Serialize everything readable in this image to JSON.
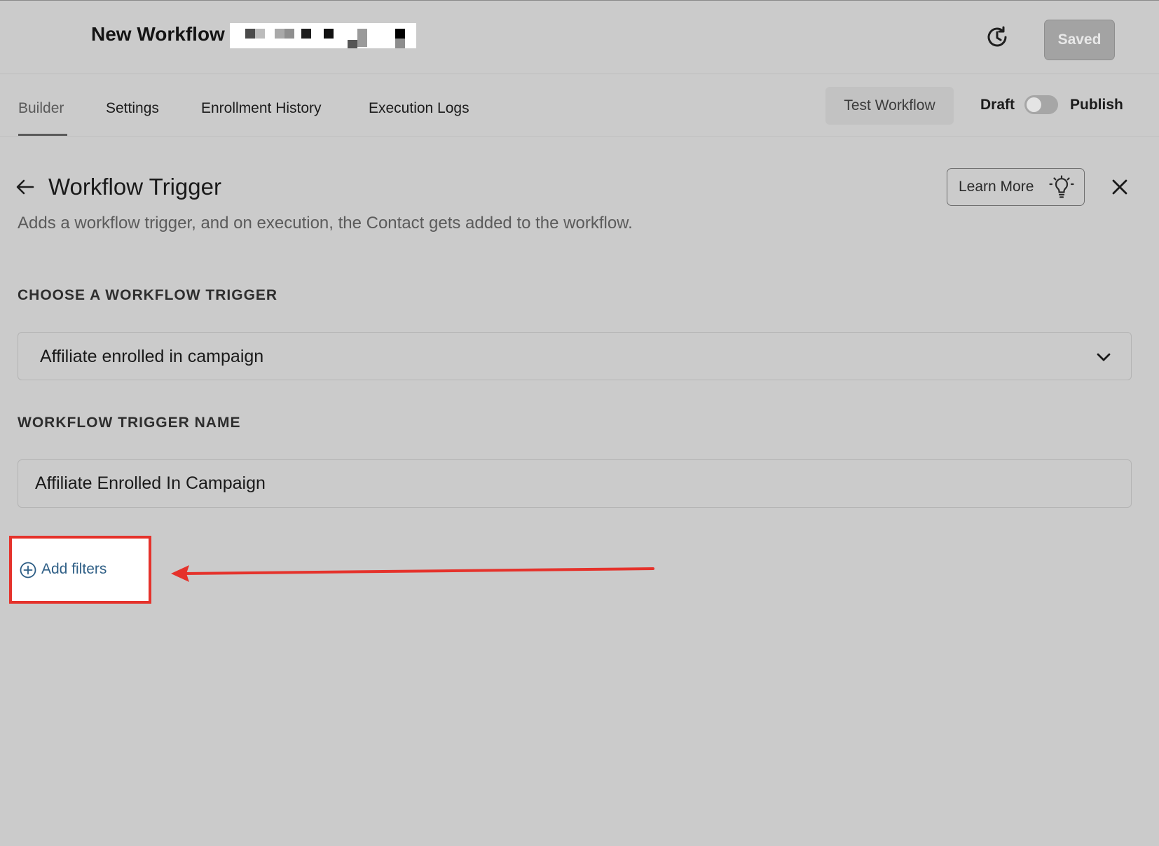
{
  "header": {
    "workflow_title": "New Workflow",
    "saved_label": "Saved"
  },
  "tabs": [
    {
      "label": "Builder",
      "active": true
    },
    {
      "label": "Settings",
      "active": false
    },
    {
      "label": "Enrollment History",
      "active": false
    },
    {
      "label": "Execution Logs",
      "active": false
    }
  ],
  "toolbar": {
    "test_label": "Test Workflow",
    "draft_label": "Draft",
    "publish_label": "Publish",
    "published": false
  },
  "panel": {
    "title": "Workflow Trigger",
    "description": "Adds a workflow trigger, and on execution, the Contact gets added to the workflow.",
    "learn_more_label": "Learn More",
    "trigger_section_label": "CHOOSE A WORKFLOW TRIGGER",
    "trigger_selected": "Affiliate enrolled in campaign",
    "name_section_label": "WORKFLOW TRIGGER NAME",
    "name_value": "Affiliate Enrolled In Campaign",
    "add_filters_label": "Add filters"
  },
  "colors": {
    "background": "#cbcbcb",
    "highlight_border": "#e5322b",
    "link": "#2f5f86"
  },
  "icons": {
    "history": "clock-history-icon",
    "back": "arrow-left-icon",
    "learn": "lightbulb-icon",
    "close": "close-icon",
    "dropdown": "chevron-down-icon",
    "add": "plus-circle-icon"
  }
}
